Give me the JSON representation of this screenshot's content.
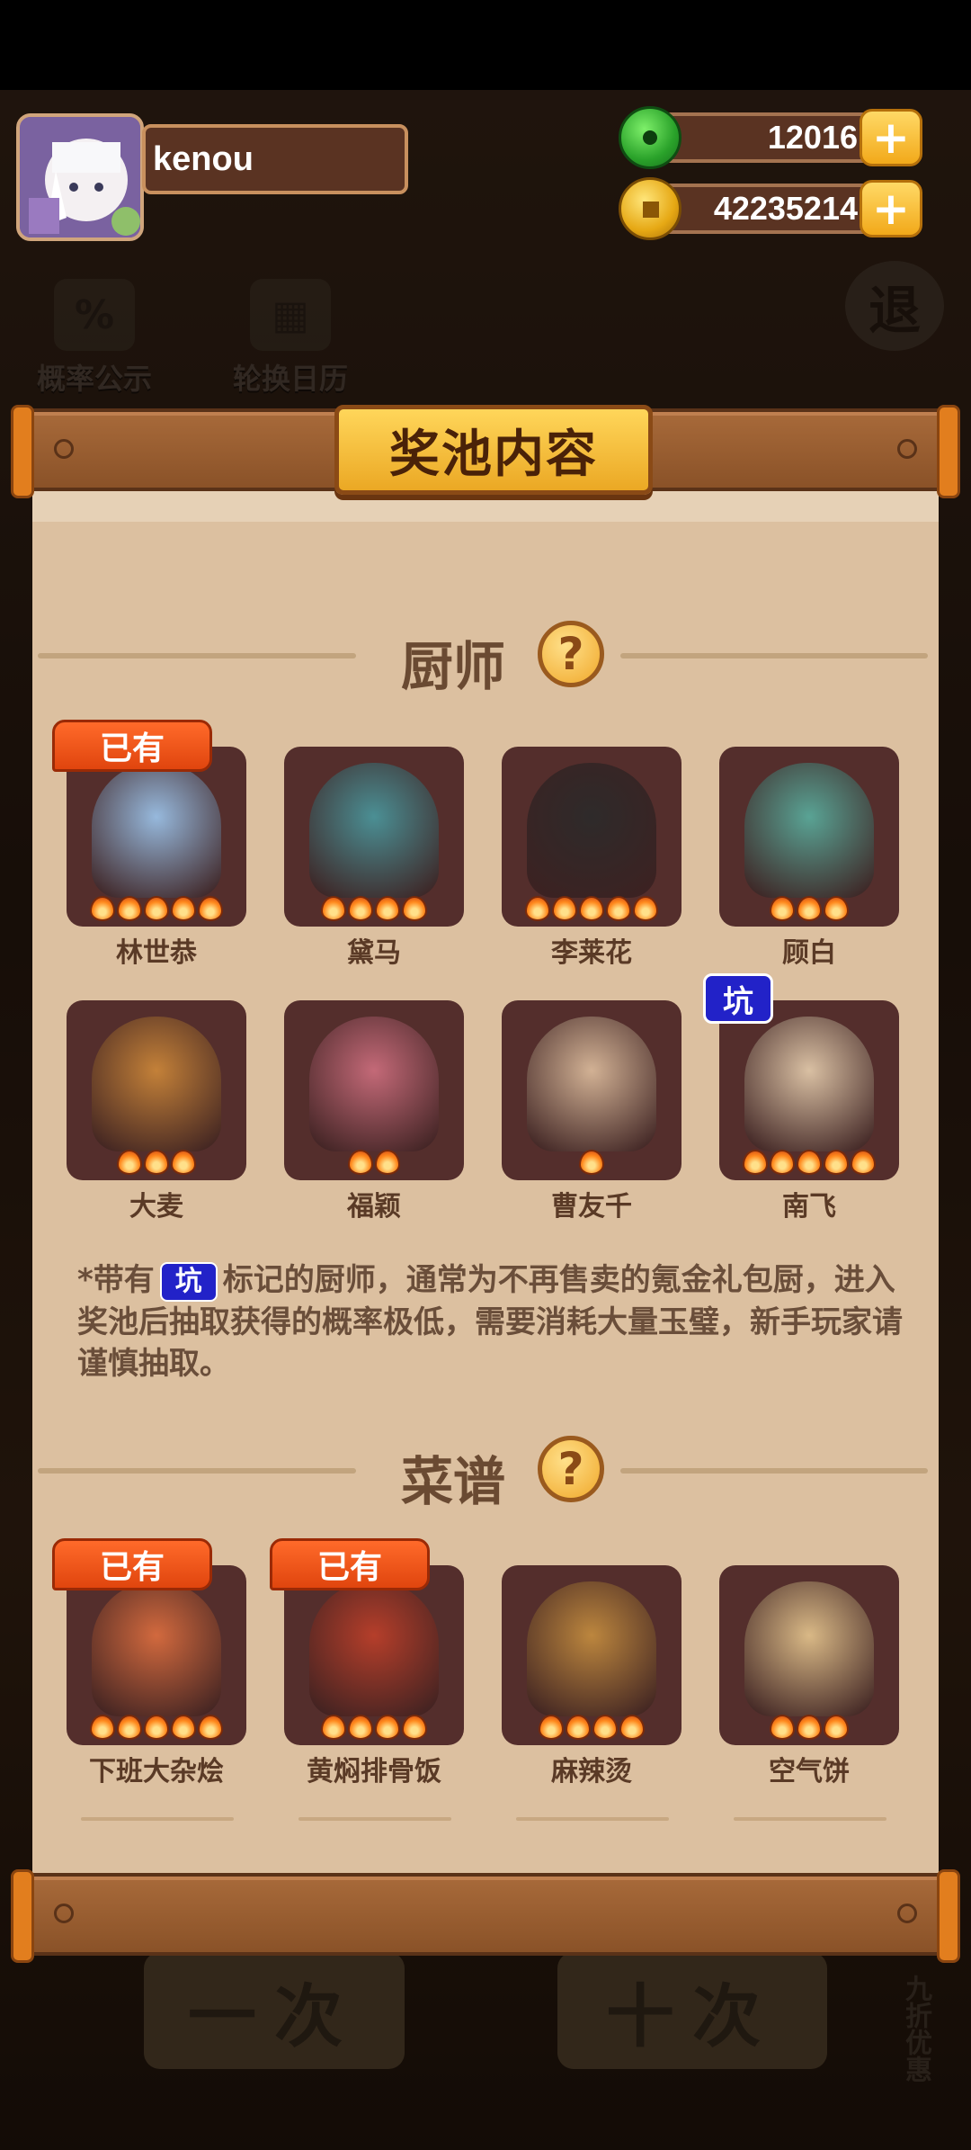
{
  "player": {
    "name": "kenou"
  },
  "currency": {
    "jade": "12016",
    "coins": "42235214",
    "plus": "+"
  },
  "background": {
    "probability_label": "概率公示",
    "calendar_label": "轮换日历",
    "exit_label": "退",
    "single_draw_label": "一次",
    "ten_draw_label": "十次",
    "discount_label": "九折优惠"
  },
  "modal": {
    "title": "奖池内容",
    "chef_section": "厨师",
    "recipe_section": "菜谱",
    "help": "?",
    "owned_badge": "已有",
    "pit_badge": "坑",
    "note_prefix": "*带有",
    "note_suffix": "标记的厨师，通常为不再售卖的氪金礼包厨，进入奖池后抽取获得的概率极低，需要消耗大量玉璧，新手玩家请谨慎抽取。"
  },
  "chefs": [
    {
      "name": "林世恭",
      "stars": 5,
      "owned": true,
      "pit": false,
      "color": "#9ec8f0"
    },
    {
      "name": "黛马",
      "stars": 4,
      "owned": false,
      "pit": false,
      "color": "#4a9aa0"
    },
    {
      "name": "李莱花",
      "stars": 5,
      "owned": false,
      "pit": false,
      "color": "#2a2a2a"
    },
    {
      "name": "顾白",
      "stars": 3,
      "owned": false,
      "pit": false,
      "color": "#5ab0a0"
    },
    {
      "name": "大麦",
      "stars": 3,
      "owned": false,
      "pit": false,
      "color": "#d08a3a"
    },
    {
      "name": "福颖",
      "stars": 2,
      "owned": false,
      "pit": false,
      "color": "#d07080"
    },
    {
      "name": "曹友千",
      "stars": 1,
      "owned": false,
      "pit": false,
      "color": "#e0c0a0"
    },
    {
      "name": "南飞",
      "stars": 5,
      "owned": false,
      "pit": true,
      "color": "#e8d0b0"
    }
  ],
  "recipes": [
    {
      "name": "下班大杂烩",
      "stars": 5,
      "owned": true,
      "color": "#e07040"
    },
    {
      "name": "黄焖排骨饭",
      "stars": 4,
      "owned": true,
      "color": "#c0402a"
    },
    {
      "name": "麻辣烫",
      "stars": 4,
      "owned": false,
      "color": "#c89040"
    },
    {
      "name": "空气饼",
      "stars": 3,
      "owned": false,
      "color": "#e8c890"
    }
  ]
}
